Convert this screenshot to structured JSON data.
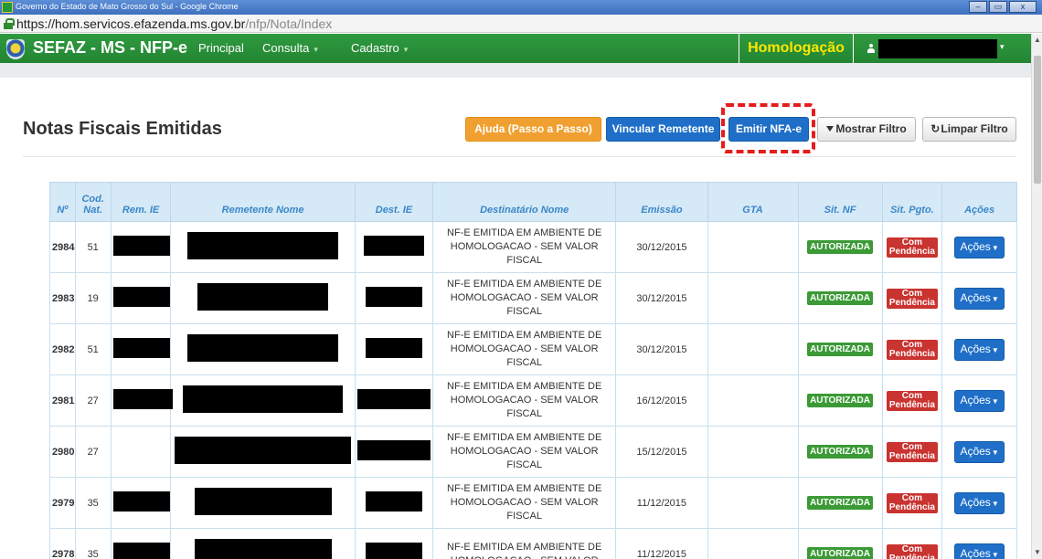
{
  "window": {
    "title": "Governo do Estado de Mato Grosso do Sul - Google Chrome",
    "minimize": "–",
    "maximize": "▭",
    "close": "x"
  },
  "address": {
    "url_host": "https://hom.servicos.efazenda.ms.gov.br",
    "url_path": "/nfp/Nota/Index"
  },
  "navbar": {
    "brand": "SEFAZ - MS - NFP-e",
    "items": [
      {
        "label": "Principal"
      },
      {
        "label": "Consulta"
      },
      {
        "label": "Cadastro"
      }
    ],
    "environment": "Homologação"
  },
  "page": {
    "title": "Notas Fiscais Emitidas",
    "buttons": {
      "ajuda": "Ajuda (Passo a Passo)",
      "vincular": "Vincular Remetente",
      "emitir": "Emitir NFA-e",
      "mostrar_filtro": "Mostrar Filtro",
      "limpar_filtro": "Limpar Filtro"
    }
  },
  "table": {
    "headers": [
      "Nº",
      "Cod. Nat.",
      "Rem. IE",
      "Remetente Nome",
      "Dest. IE",
      "Destinatário Nome",
      "Emissão",
      "GTA",
      "Sit. NF",
      "Sit. Pgto.",
      "Ações"
    ],
    "rows": [
      {
        "num": "2984",
        "cod": "51",
        "dest_nome": "NF-E EMITIDA EM AMBIENTE DE HOMOLOGACAO - SEM VALOR FISCAL",
        "emissao": "30/12/2015",
        "gta": "",
        "sit_nf": "AUTORIZADA",
        "sit_pgto_1": "Com",
        "sit_pgto_2": "Pendência",
        "acoes": "Ações"
      },
      {
        "num": "2983",
        "cod": "19",
        "dest_nome": "NF-E EMITIDA EM AMBIENTE DE HOMOLOGACAO - SEM VALOR FISCAL",
        "emissao": "30/12/2015",
        "gta": "",
        "sit_nf": "AUTORIZADA",
        "sit_pgto_1": "Com",
        "sit_pgto_2": "Pendência",
        "acoes": "Ações"
      },
      {
        "num": "2982",
        "cod": "51",
        "dest_nome": "NF-E EMITIDA EM AMBIENTE DE HOMOLOGACAO - SEM VALOR FISCAL",
        "emissao": "30/12/2015",
        "gta": "",
        "sit_nf": "AUTORIZADA",
        "sit_pgto_1": "Com",
        "sit_pgto_2": "Pendência",
        "acoes": "Ações"
      },
      {
        "num": "2981",
        "cod": "27",
        "dest_nome": "NF-E EMITIDA EM AMBIENTE DE HOMOLOGACAO - SEM VALOR FISCAL",
        "emissao": "16/12/2015",
        "gta": "",
        "sit_nf": "AUTORIZADA",
        "sit_pgto_1": "Com",
        "sit_pgto_2": "Pendência",
        "acoes": "Ações"
      },
      {
        "num": "2980",
        "cod": "27",
        "dest_nome": "NF-E EMITIDA EM AMBIENTE DE HOMOLOGACAO - SEM VALOR FISCAL",
        "emissao": "15/12/2015",
        "gta": "",
        "sit_nf": "AUTORIZADA",
        "sit_pgto_1": "Com",
        "sit_pgto_2": "Pendência",
        "acoes": "Ações"
      },
      {
        "num": "2979",
        "cod": "35",
        "dest_nome": "NF-E EMITIDA EM AMBIENTE DE HOMOLOGACAO - SEM VALOR FISCAL",
        "emissao": "11/12/2015",
        "gta": "",
        "sit_nf": "AUTORIZADA",
        "sit_pgto_1": "Com",
        "sit_pgto_2": "Pendência",
        "acoes": "Ações"
      },
      {
        "num": "2978",
        "cod": "35",
        "dest_nome": "NF-E EMITIDA EM AMBIENTE DE HOMOLOGACAO - SEM VALOR",
        "emissao": "11/12/2015",
        "gta": "",
        "sit_nf": "AUTORIZADA",
        "sit_pgto_1": "Com",
        "sit_pgto_2": "Pendência",
        "acoes": "Ações"
      }
    ]
  },
  "colors": {
    "navbar": "#2f9a3f",
    "environment_text": "#ffe600",
    "primary": "#1f6fc8",
    "warning": "#f0a030",
    "success": "#3b9a36",
    "danger": "#c93330",
    "highlight": "#e41c1c"
  }
}
